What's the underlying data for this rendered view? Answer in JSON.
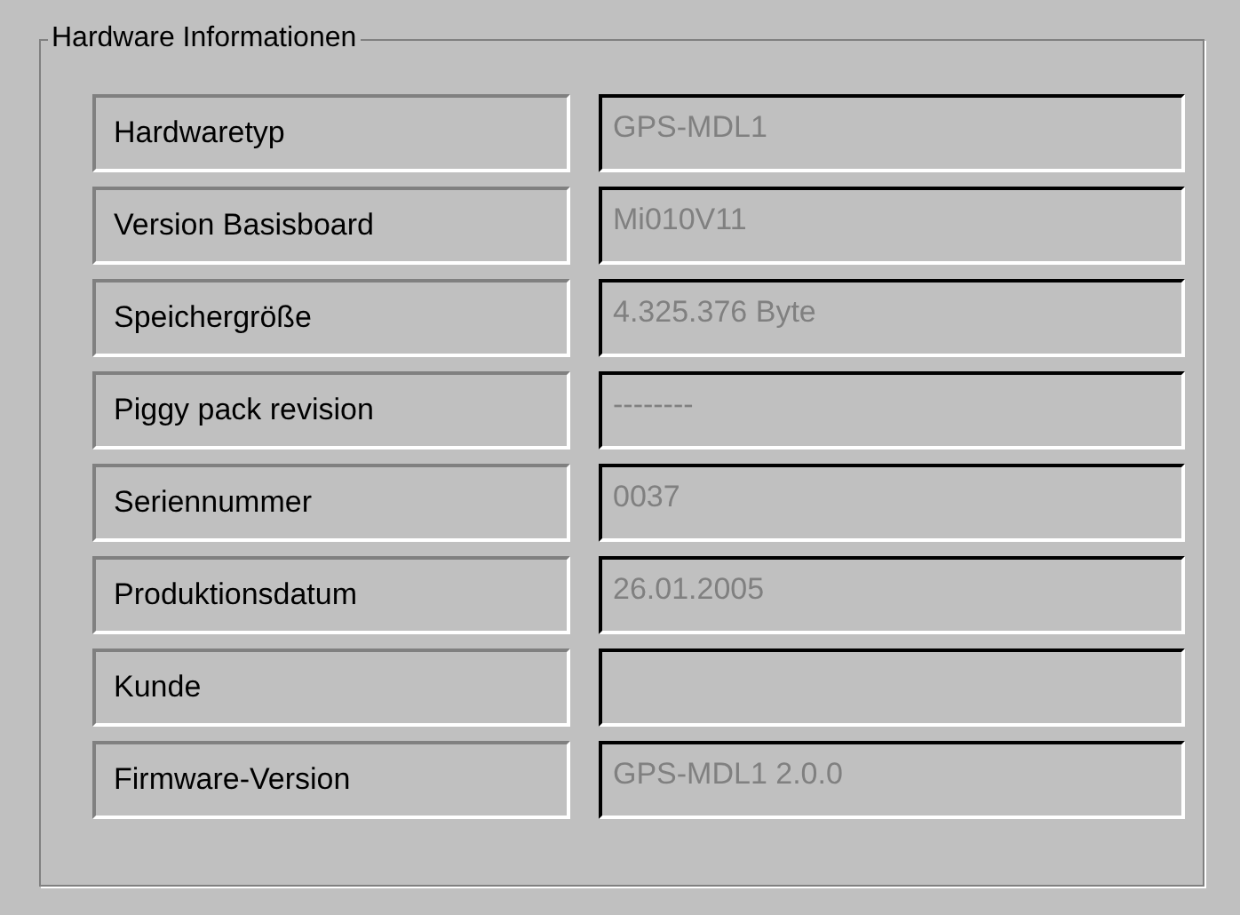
{
  "group": {
    "title": "Hardware Informationen"
  },
  "fields": [
    {
      "label": "Hardwaretyp",
      "value": "GPS-MDL1",
      "disabled": true
    },
    {
      "label": "Version Basisboard",
      "value": "Mi010V11",
      "disabled": true
    },
    {
      "label": "Speichergröße",
      "value": "4.325.376 Byte",
      "disabled": true
    },
    {
      "label": "Piggy pack revision",
      "value": "--------",
      "disabled": true
    },
    {
      "label": "Seriennummer",
      "value": "0037",
      "disabled": true
    },
    {
      "label": "Produktionsdatum",
      "value": "26.01.2005",
      "disabled": true
    },
    {
      "label": "Kunde",
      "disabled": true
    },
    {
      "label": "Firmware-Version",
      "value": "GPS-MDL1 2.0.0",
      "disabled": true
    }
  ]
}
